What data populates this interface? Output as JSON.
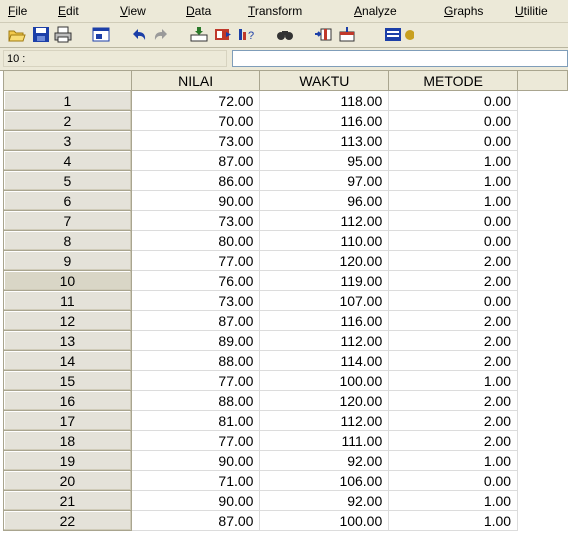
{
  "menu": [
    {
      "label": "File",
      "underline": "F"
    },
    {
      "label": "Edit",
      "underline": "E"
    },
    {
      "label": "View",
      "underline": "V"
    },
    {
      "label": "Data",
      "underline": "D"
    },
    {
      "label": "Transform",
      "underline": "T"
    },
    {
      "label": "Analyze",
      "underline": "A"
    },
    {
      "label": "Graphs",
      "underline": "G"
    },
    {
      "label": "Utilitie",
      "underline": "U"
    }
  ],
  "cell_editor": {
    "ref": "10 :",
    "value": ""
  },
  "columns": [
    "NILAI",
    "WAKTU",
    "METODE"
  ],
  "selected_row": 10,
  "rows": [
    {
      "n": "1",
      "nilai": "72.00",
      "waktu": "118.00",
      "metode": "0.00"
    },
    {
      "n": "2",
      "nilai": "70.00",
      "waktu": "116.00",
      "metode": "0.00"
    },
    {
      "n": "3",
      "nilai": "73.00",
      "waktu": "113.00",
      "metode": "0.00"
    },
    {
      "n": "4",
      "nilai": "87.00",
      "waktu": "95.00",
      "metode": "1.00"
    },
    {
      "n": "5",
      "nilai": "86.00",
      "waktu": "97.00",
      "metode": "1.00"
    },
    {
      "n": "6",
      "nilai": "90.00",
      "waktu": "96.00",
      "metode": "1.00"
    },
    {
      "n": "7",
      "nilai": "73.00",
      "waktu": "112.00",
      "metode": "0.00"
    },
    {
      "n": "8",
      "nilai": "80.00",
      "waktu": "110.00",
      "metode": "0.00"
    },
    {
      "n": "9",
      "nilai": "77.00",
      "waktu": "120.00",
      "metode": "2.00"
    },
    {
      "n": "10",
      "nilai": "76.00",
      "waktu": "119.00",
      "metode": "2.00"
    },
    {
      "n": "11",
      "nilai": "73.00",
      "waktu": "107.00",
      "metode": "0.00"
    },
    {
      "n": "12",
      "nilai": "87.00",
      "waktu": "116.00",
      "metode": "2.00"
    },
    {
      "n": "13",
      "nilai": "89.00",
      "waktu": "112.00",
      "metode": "2.00"
    },
    {
      "n": "14",
      "nilai": "88.00",
      "waktu": "114.00",
      "metode": "2.00"
    },
    {
      "n": "15",
      "nilai": "77.00",
      "waktu": "100.00",
      "metode": "1.00"
    },
    {
      "n": "16",
      "nilai": "88.00",
      "waktu": "120.00",
      "metode": "2.00"
    },
    {
      "n": "17",
      "nilai": "81.00",
      "waktu": "112.00",
      "metode": "2.00"
    },
    {
      "n": "18",
      "nilai": "77.00",
      "waktu": "111.00",
      "metode": "2.00"
    },
    {
      "n": "19",
      "nilai": "90.00",
      "waktu": "92.00",
      "metode": "1.00"
    },
    {
      "n": "20",
      "nilai": "71.00",
      "waktu": "106.00",
      "metode": "0.00"
    },
    {
      "n": "21",
      "nilai": "90.00",
      "waktu": "92.00",
      "metode": "1.00"
    },
    {
      "n": "22",
      "nilai": "87.00",
      "waktu": "100.00",
      "metode": "1.00"
    }
  ],
  "toolbar_icons": [
    "open-folder-icon",
    "save-icon",
    "print-icon",
    "dialog-recall-icon",
    "undo-icon",
    "redo-icon",
    "goto-case-icon",
    "insert-variable-icon",
    "variables-icon",
    "find-icon",
    "insert-case-icon",
    "split-file-icon",
    "weight-cases-icon",
    "select-cases-icon"
  ],
  "colors": {
    "chrome": "#ece9d8",
    "grid_line": "#dcdcdc"
  }
}
